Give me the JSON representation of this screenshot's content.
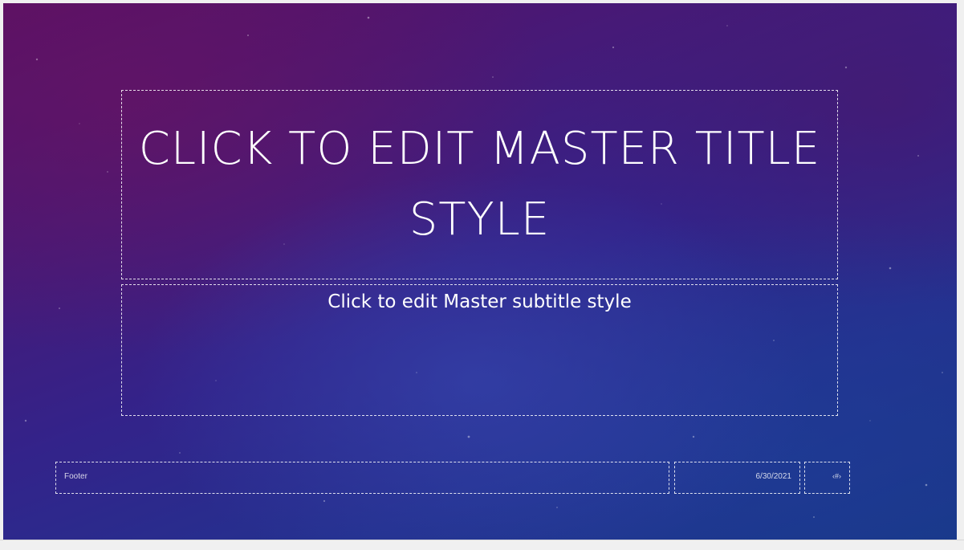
{
  "slide": {
    "title": "CLICK TO EDIT MASTER TITLE STYLE",
    "subtitle": "Click to edit Master subtitle style",
    "footer": "Footer",
    "date": "6/30/2021",
    "slide_number": "‹#›"
  },
  "colors": {
    "background_top": "#5a0f63",
    "background_bottom": "#173886",
    "text": "#ffffff",
    "placeholder_border": "#ffffff",
    "frame": "#f0f0f0"
  }
}
